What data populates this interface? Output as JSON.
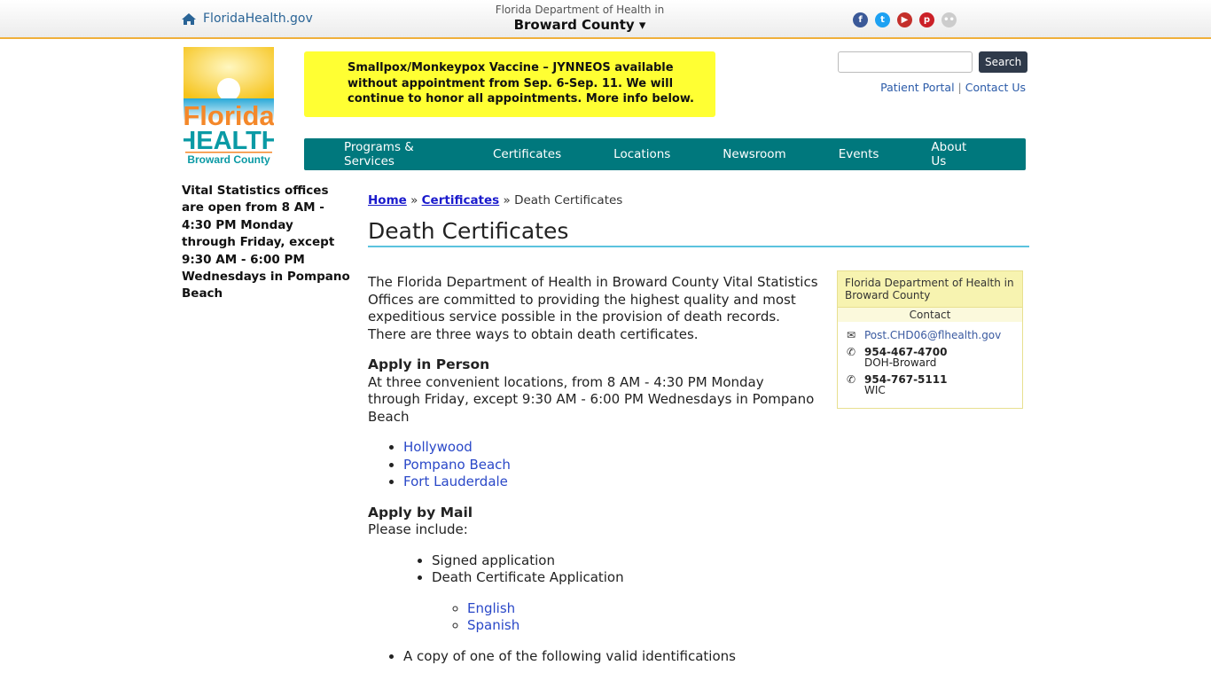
{
  "topbar": {
    "home_label": "FloridaHealth.gov",
    "dept_line1": "Florida Department of Health in",
    "dept_county": "Broward County ▾",
    "social": [
      {
        "icon": "facebook-icon",
        "glyph": "f",
        "color": "#3b5998"
      },
      {
        "icon": "twitter-icon",
        "glyph": "t",
        "color": "#1da1f2"
      },
      {
        "icon": "youtube-icon",
        "glyph": "▶",
        "color": "#c4302b"
      },
      {
        "icon": "pinterest-icon",
        "glyph": "p",
        "color": "#cb2027"
      },
      {
        "icon": "flickr-icon",
        "glyph": "••",
        "color": "#cccccc"
      }
    ]
  },
  "logo": {
    "text1": "Florida",
    "text2": "HEALTH",
    "text3": "Broward County"
  },
  "alert": "Smallpox/Monkeypox Vaccine – JYNNEOS available without appointment from Sep. 6-Sep. 11. We will continue to honor all appointments. More info below.",
  "search": {
    "button": "Search",
    "value": ""
  },
  "links": {
    "portal": "Patient Portal",
    "sep": " | ",
    "contact": "Contact Us"
  },
  "nav": [
    "Programs & Services",
    "Certificates",
    "Locations",
    "Newsroom",
    "Events",
    "About Us"
  ],
  "sidebar": "Vital Statistics offices are open from 8 AM - 4:30 PM Monday through Friday, except 9:30 AM - 6:00 PM Wednesdays in Pompano Beach",
  "breadcrumb": {
    "home": "Home",
    "certificates": "Certificates",
    "sep": " » ",
    "current": "Death Certificates"
  },
  "title": "Death Certificates",
  "content": {
    "intro": "The Florida Department of Health in Broward County Vital Statistics Offices are committed to providing the highest quality and most expeditious service possible in the provision of death records. There are three ways to obtain death certificates.",
    "person_heading": "Apply in Person",
    "person_text": "At three convenient locations, from 8 AM - 4:30 PM Monday through Friday, except 9:30 AM - 6:00 PM Wednesdays in Pompano Beach",
    "locations": [
      "Hollywood",
      "Pompano Beach",
      "Fort Lauderdale"
    ],
    "mail_heading": "Apply by Mail",
    "mail_text": "Please include:",
    "mail_items": [
      "Signed application",
      "Death Certificate Application"
    ],
    "languages": [
      "English",
      "Spanish"
    ],
    "id_item": "A copy of one of the following valid identifications"
  },
  "contact_box": {
    "header": "Florida Department of Health in Broward County",
    "title": "Contact",
    "email": "Post.CHD06@flhealth.gov",
    "phones": [
      {
        "number": "954-467-4700",
        "label": "DOH-Broward"
      },
      {
        "number": "954-767-5111",
        "label": "WIC"
      }
    ]
  }
}
